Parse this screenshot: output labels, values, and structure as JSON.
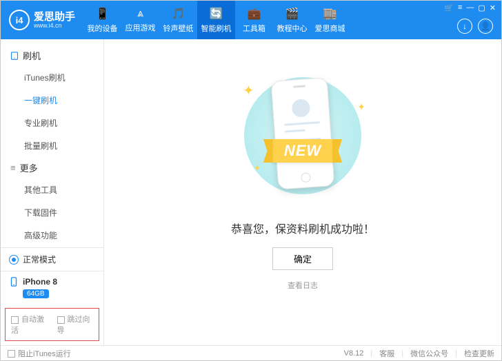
{
  "brand": {
    "name": "爱思助手",
    "url": "www.i4.cn",
    "logo_text": "i4"
  },
  "nav": [
    {
      "label": "我的设备",
      "icon": "📱"
    },
    {
      "label": "应用游戏",
      "icon": "⩓"
    },
    {
      "label": "铃声壁纸",
      "icon": "🎵"
    },
    {
      "label": "智能刷机",
      "icon": "🔄",
      "active": true
    },
    {
      "label": "工具箱",
      "icon": "💼"
    },
    {
      "label": "教程中心",
      "icon": "🎬"
    },
    {
      "label": "爱思商城",
      "icon": "🏬"
    }
  ],
  "sidebar": {
    "group1": {
      "title": "刷机",
      "items": [
        "iTunes刷机",
        "一键刷机",
        "专业刷机",
        "批量刷机"
      ],
      "active_index": 1
    },
    "group2": {
      "title": "更多",
      "items": [
        "其他工具",
        "下载固件",
        "高级功能"
      ]
    }
  },
  "status": {
    "mode": "正常模式"
  },
  "device": {
    "name": "iPhone 8",
    "storage": "64GB"
  },
  "checks": {
    "auto_activate": "自动激活",
    "skip_guide": "跳过向导"
  },
  "main": {
    "ribbon": "NEW",
    "message": "恭喜您，保资料刷机成功啦！",
    "ok": "确定",
    "view_log": "查看日志"
  },
  "footer": {
    "block_itunes": "阻止iTunes运行",
    "version": "V8.12",
    "links": [
      "客服",
      "微信公众号",
      "检查更新"
    ]
  }
}
